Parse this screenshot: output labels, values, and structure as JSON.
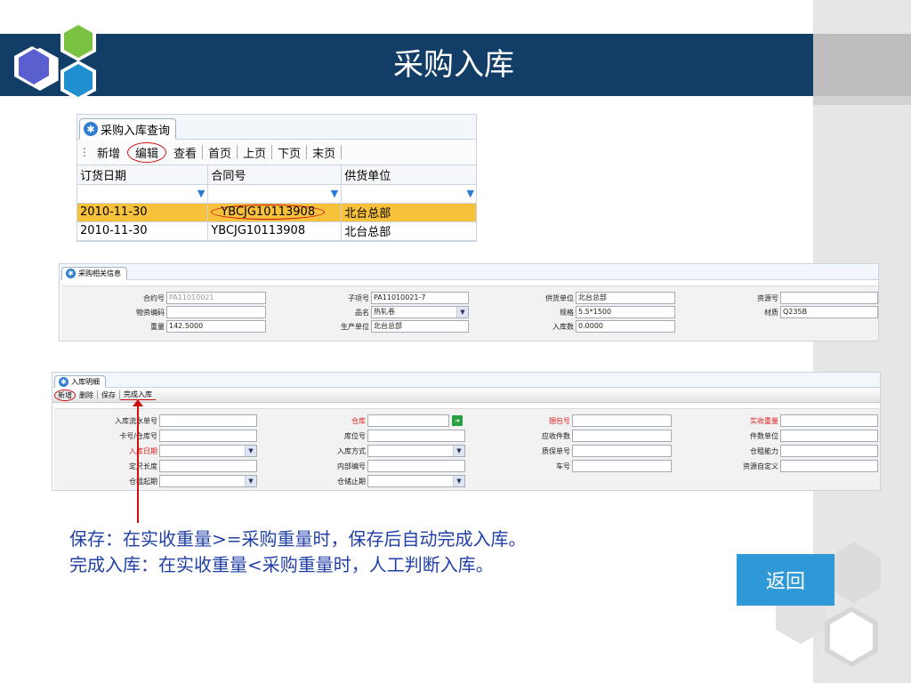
{
  "page": {
    "title": "采购入库"
  },
  "query_panel": {
    "tab_label": "采购入库查询",
    "toolbar": [
      "新增",
      "编辑",
      "查看",
      "首页",
      "上页",
      "下页",
      "末页"
    ],
    "columns": [
      "订货日期",
      "合同号",
      "供货单位"
    ],
    "rows": [
      [
        "2010-11-30",
        "YBCJG10113908",
        "北台总部"
      ],
      [
        "2010-11-30",
        "YBCJG10113908",
        "北台总部"
      ]
    ]
  },
  "info_panel": {
    "tab_label": "采购相关信息",
    "fields": {
      "contract_no": {
        "label": "合约号",
        "value": "PA11010021"
      },
      "material_code": {
        "label": "物资编码",
        "value": ""
      },
      "weight": {
        "label": "重量",
        "value": "142.5000"
      },
      "sub_item_no": {
        "label": "子项号",
        "value": "PA11010021-7"
      },
      "product_name": {
        "label": "品名",
        "value": "热轧卷"
      },
      "producer": {
        "label": "生产单位",
        "value": "北台总部"
      },
      "supplier": {
        "label": "供货单位",
        "value": "北台总部"
      },
      "spec": {
        "label": "规格",
        "value": "5.5*1500"
      },
      "stock_in_qty": {
        "label": "入库数",
        "value": "0.0000"
      },
      "resource_no": {
        "label": "资源号",
        "value": ""
      },
      "grade": {
        "label": "材质",
        "value": "Q235B"
      }
    }
  },
  "detail_panel": {
    "tab_label": "入库明细",
    "toolbar": [
      "新增",
      "删除",
      "保存",
      "完成入库"
    ],
    "fields": {
      "flow_no": {
        "label": "入库流水单号",
        "value": ""
      },
      "card_no": {
        "label": "卡号/仓库号",
        "value": ""
      },
      "in_date": {
        "label": "入库日期",
        "value": ""
      },
      "fixed_length": {
        "label": "定尺长度",
        "value": ""
      },
      "lease_start": {
        "label": "仓租起期",
        "value": ""
      },
      "warehouse": {
        "label": "仓库",
        "value": ""
      },
      "location_no": {
        "label": "库位号",
        "value": ""
      },
      "in_method": {
        "label": "入库方式",
        "value": ""
      },
      "internal_no": {
        "label": "内部编号",
        "value": ""
      },
      "lease_end": {
        "label": "仓储止期",
        "value": ""
      },
      "bundle_no": {
        "label": "捆包号",
        "value": ""
      },
      "expected_pieces": {
        "label": "应收件数",
        "value": ""
      },
      "warranty_no": {
        "label": "质保单号",
        "value": ""
      },
      "car_no": {
        "label": "车号",
        "value": ""
      },
      "actual_weight": {
        "label": "实收重量",
        "value": ""
      },
      "piece_unit": {
        "label": "件数单位",
        "value": ""
      },
      "storage_capacity": {
        "label": "仓租能力",
        "value": ""
      },
      "resource_custom": {
        "label": "资源自定义",
        "value": ""
      }
    }
  },
  "notes": [
    "保存：在实收重量>=采购重量时，保存后自动完成入库。",
    "完成入库：在实收重量<采购重量时，人工判断入库。"
  ],
  "back_button": "返回",
  "colors": {
    "title_bar": "#123d66",
    "selected_row": "#f8c13c",
    "annotation": "#cc1111",
    "note_text": "#2040a8",
    "back_button": "#2f98d6"
  }
}
